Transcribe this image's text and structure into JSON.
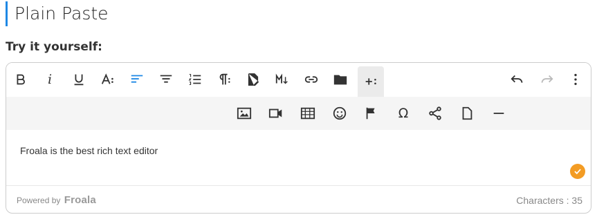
{
  "page": {
    "title": "Plain Paste",
    "subtitle": "Try it yourself:"
  },
  "editor": {
    "content_text": "Froala is the best rich text editor",
    "footer": {
      "powered_by_label": "Powered by",
      "brand_name": "Froala",
      "characters_label": "Characters : 35"
    }
  },
  "toolbar": {
    "row1": [
      "bold",
      "italic",
      "underline",
      "font-size",
      "align-left",
      "align-center",
      "ordered-list",
      "paragraph-format",
      "insert-file",
      "markdown",
      "insert-link",
      "folder",
      "more-rich",
      "undo",
      "redo",
      "more-misc"
    ],
    "row2": [
      "insert-image",
      "insert-video",
      "insert-table",
      "emoticons",
      "flag",
      "special-characters",
      "share",
      "insert-file",
      "horizontal-line"
    ]
  },
  "colors": {
    "accent": "#1e88e5",
    "check_badge": "#f39c24"
  }
}
